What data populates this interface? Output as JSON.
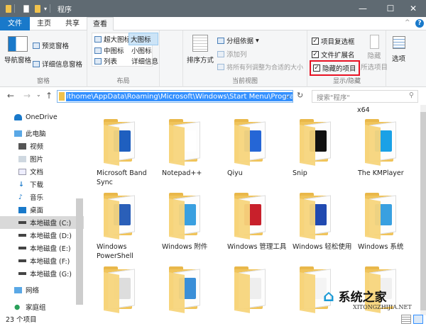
{
  "window": {
    "title": "程序",
    "minimize": "—",
    "maximize": "☐",
    "close": "✕"
  },
  "tabs": [
    "文件",
    "主页",
    "共享",
    "查看"
  ],
  "ribbon": {
    "panes": {
      "nav_pane": "导航窗格",
      "preview": "预览窗格",
      "details": "详细信息窗格",
      "label": "窗格"
    },
    "layout": {
      "items": [
        "超大图标",
        "大图标",
        "中图标",
        "小图标",
        "列表",
        "详细信息"
      ],
      "label": "布局"
    },
    "current_view": {
      "sort": "排序方式",
      "group": "分组依据",
      "add_col": "添加列",
      "fit": "将所有列调整为合适的大小",
      "label": "当前视图"
    },
    "show_hide": {
      "item_checkbox": "项目复选框",
      "extensions": "文件扩展名",
      "hidden_items": "隐藏的项目",
      "hide_selected": "隐藏",
      "hide_selected2": "所选项目",
      "label": "显示/隐藏"
    },
    "options": "选项",
    "highlight_color": "#e81123"
  },
  "address": {
    "path": "ithome\\AppData\\Roaming\\Microsoft\\Windows\\Start Menu\\Programs",
    "search_placeholder": "搜索\"程序\""
  },
  "nav": {
    "onedrive": "OneDrive",
    "thispc": "此电脑",
    "children": [
      "视频",
      "图片",
      "文档",
      "下载",
      "音乐",
      "桌面"
    ],
    "drives": [
      "本地磁盘 (C:)",
      "本地磁盘 (D:)",
      "本地磁盘 (E:)",
      "本地磁盘 (F:)",
      "本地磁盘 (G:)"
    ],
    "network": "网络",
    "homegroup": "家庭组"
  },
  "header_label": "x64",
  "items": [
    "Microsoft Band Sync",
    "Notepad++",
    "Qiyu",
    "Snip",
    "The KMPlayer",
    "Windows PowerShell",
    "Windows 附件",
    "Windows 管理工具",
    "Windows 轻松使用",
    "Windows 系统",
    "",
    "",
    "",
    "",
    ""
  ],
  "status": "23 个项目",
  "watermark": {
    "cn": "系统之家",
    "en": "XITONGZHIJIA.NET"
  }
}
